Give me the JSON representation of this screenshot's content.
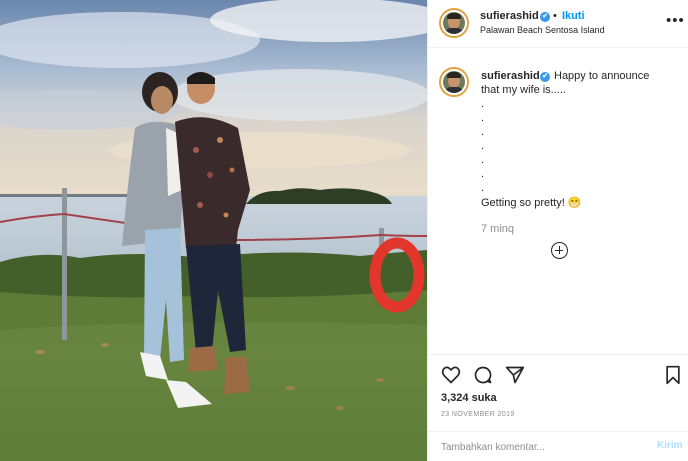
{
  "post": {
    "username": "sufierashid",
    "verified_mark": "✔",
    "separator": "•",
    "follow_label": "Ikuti",
    "location": "Palawan Beach Sentosa Island",
    "more_icon": "more-horizontal-icon",
    "more_glyph": "•••"
  },
  "caption": {
    "username": "sufierashid",
    "line1": "Happy to announce",
    "line2": "that my wife is.....",
    "dots": [
      ".",
      ".",
      ".",
      ".",
      ".",
      ".",
      "."
    ],
    "closing": "Getting so pretty! 😁",
    "time": "7 minq"
  },
  "actions": {
    "like_icon": "heart-icon",
    "comment_icon": "comment-icon",
    "share_icon": "share-icon",
    "save_icon": "bookmark-icon",
    "likes": "3,324 suka",
    "date": "23 NOVEMBER 2019"
  },
  "comment": {
    "placeholder": "Tambahkan komentar...",
    "send_label": "Kirim"
  },
  "colors": {
    "accent": "#0095f6",
    "verified": "#3897f0",
    "story_ring": "#e0a243",
    "buoy": "#e2352b"
  }
}
